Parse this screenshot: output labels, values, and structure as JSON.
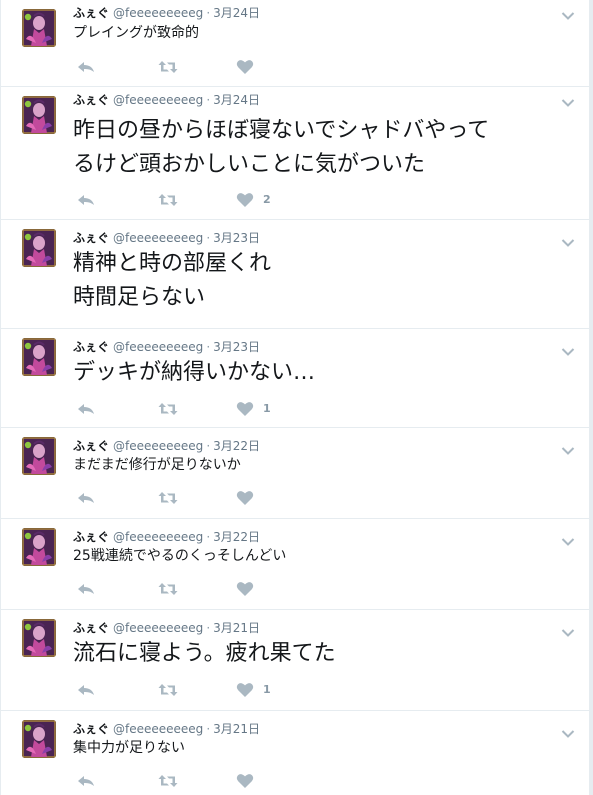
{
  "user": {
    "fullname": "ふぇぐ",
    "username": "@feeeeeeeeeg",
    "separator": "·"
  },
  "tweets": [
    {
      "date": "3月24日",
      "text": "プレイングが致命的",
      "likes": ""
    },
    {
      "date": "3月24日",
      "text": "昨日の昼からほぼ寝ないでシャドバやって",
      "text2": "るけど頭おかしいことに気がついた",
      "likes": "2"
    },
    {
      "date": "3月23日",
      "text": "精神と時の部屋くれ",
      "text2": "時間足らない",
      "likes": ""
    },
    {
      "date": "3月23日",
      "text": "デッキが納得いかない…",
      "likes": "1"
    },
    {
      "date": "3月22日",
      "text": "まだまだ修行が足りないか",
      "likes": ""
    },
    {
      "date": "3月22日",
      "text": "25戦連続でやるのくっそしんどい",
      "likes": ""
    },
    {
      "date": "3月21日",
      "text": "流石に寝よう。疲れ果てた",
      "likes": "1"
    },
    {
      "date": "3月21日",
      "text": "集中力が足りない",
      "likes": ""
    }
  ],
  "icons": {
    "reply": "reply-icon",
    "retweet": "retweet-icon",
    "like": "heart-icon",
    "more": "chevron-down-icon"
  },
  "colors": {
    "action_gray": "#aab8c2",
    "border": "#e6ecf0",
    "text": "#14171a",
    "secondary": "#657786"
  }
}
